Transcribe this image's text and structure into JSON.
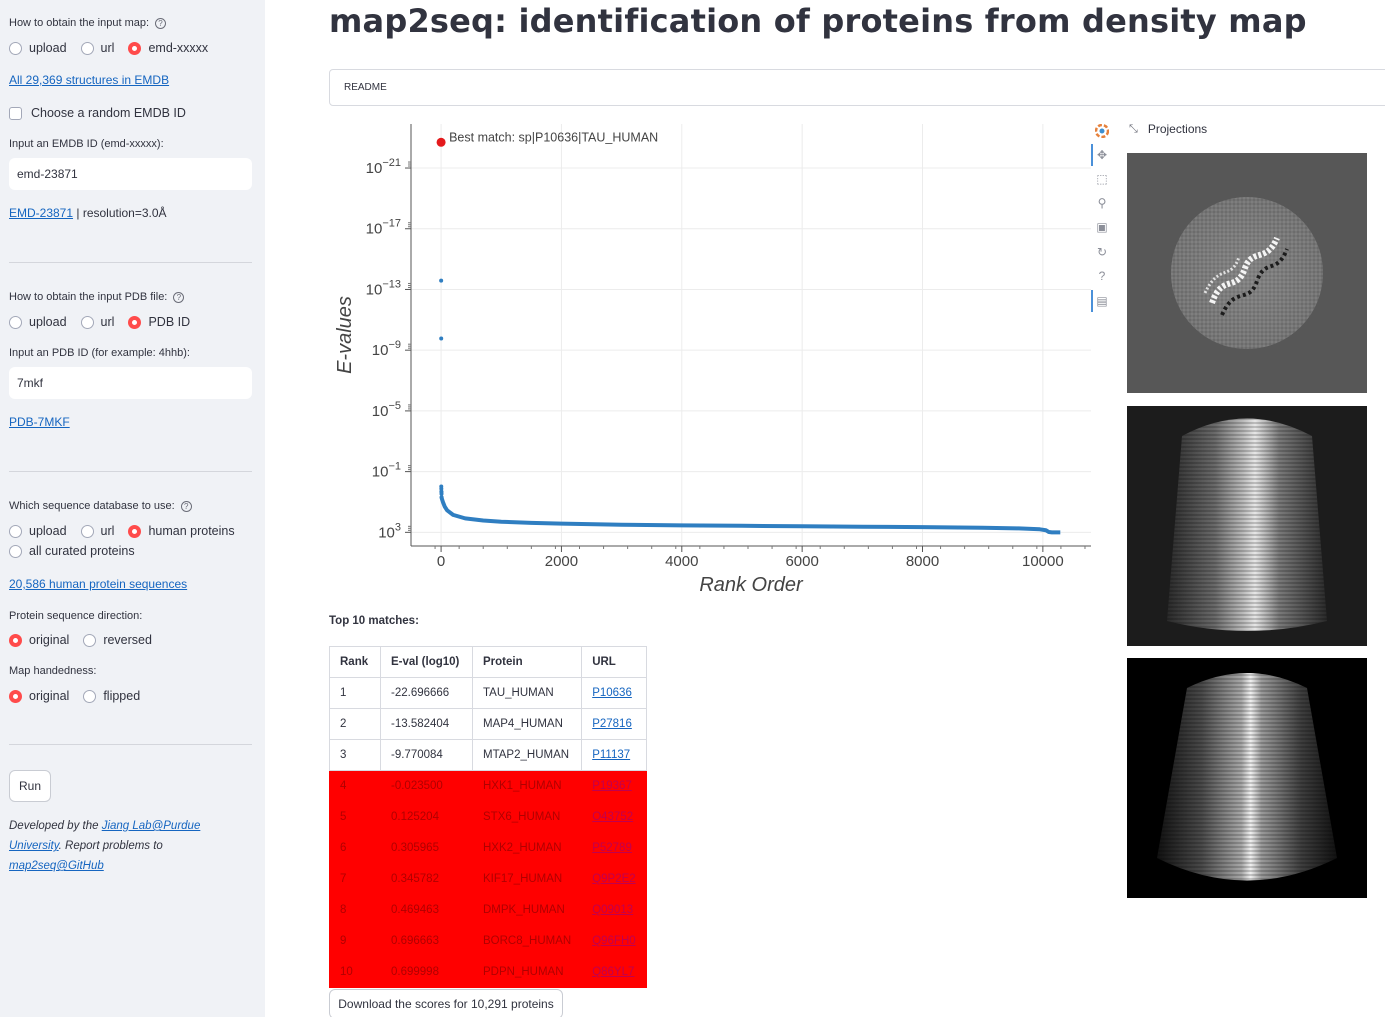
{
  "sidebar": {
    "map_source": {
      "label": "How to obtain the input map:",
      "options": [
        "upload",
        "url",
        "emd-xxxxx"
      ],
      "selected": 2
    },
    "emdb_link": "All 29,369 structures in EMDB",
    "random_checkbox": "Choose a random EMDB ID",
    "emdb_input": {
      "label": "Input an EMDB ID (emd-xxxxx):",
      "value": "emd-23871"
    },
    "emd_info": {
      "link": "EMD-23871",
      "text": " | resolution=3.0Å"
    },
    "pdb_source": {
      "label": "How to obtain the input PDB file:",
      "options": [
        "upload",
        "url",
        "PDB ID"
      ],
      "selected": 2
    },
    "pdb_input": {
      "label": "Input an PDB ID (for example: 4hhb):",
      "value": "7mkf"
    },
    "pdb_link": "PDB-7MKF",
    "seq_db": {
      "label": "Which sequence database to use:",
      "options": [
        "upload",
        "url",
        "human proteins",
        "all curated proteins"
      ],
      "selected": 2
    },
    "human_seq_link": "20,586 human protein sequences",
    "direction": {
      "label": "Protein sequence direction:",
      "options": [
        "original",
        "reversed"
      ],
      "selected": 0
    },
    "handedness": {
      "label": "Map handedness:",
      "options": [
        "original",
        "flipped"
      ],
      "selected": 0
    },
    "run_label": "Run",
    "footer": {
      "prefix": "Developed by the ",
      "lab_link": "Jiang Lab@Purdue University",
      "middle": ". Report problems to ",
      "github_link": "map2seq@GitHub"
    }
  },
  "main": {
    "title": "map2seq: identification of proteins from density map",
    "readme": "README",
    "projections_title": "Projections",
    "top10_label": "Top 10 matches:",
    "download_label": "Download the scores for 10,291 proteins"
  },
  "table": {
    "headers": [
      "Rank",
      "E-val (log10)",
      "Protein",
      "URL"
    ],
    "rows": [
      [
        "1",
        "-22.696666",
        "TAU_HUMAN",
        "P10636"
      ],
      [
        "2",
        "-13.582404",
        "MAP4_HUMAN",
        "P27816"
      ],
      [
        "3",
        "-9.770084",
        "MTAP2_HUMAN",
        "P11137"
      ],
      [
        "4",
        "-0.023500",
        "HXK1_HUMAN",
        "P19367"
      ],
      [
        "5",
        "0.125204",
        "STX6_HUMAN",
        "O43752"
      ],
      [
        "6",
        "0.305965",
        "HXK2_HUMAN",
        "P52789"
      ],
      [
        "7",
        "0.345782",
        "KIF17_HUMAN",
        "Q9P2E2"
      ],
      [
        "8",
        "0.469463",
        "DMPK_HUMAN",
        "Q09013"
      ],
      [
        "9",
        "0.696663",
        "BORC8_HUMAN",
        "Q96FH0"
      ],
      [
        "10",
        "0.699998",
        "PDPN_HUMAN",
        "Q86YL7"
      ]
    ],
    "highlight_from": 3,
    "highlight_color": "#ff0000"
  },
  "colors": {
    "accent": "#ff4b4b",
    "link": "#1565c0",
    "series": "#2f7ec1",
    "best": "#e41a1c"
  },
  "chart_data": {
    "type": "scatter",
    "xlabel": "Rank Order",
    "ylabel": "E-values",
    "yscale": "log",
    "y_reversed": true,
    "xlim": [
      -500,
      10800
    ],
    "x_ticks": [
      0,
      2000,
      4000,
      6000,
      8000,
      10000
    ],
    "y_tick_exponents": [
      -21,
      -17,
      -13,
      -9,
      -5,
      -1,
      3
    ],
    "ylim_log10": [
      -23.9,
      3.9
    ],
    "grid": true,
    "legend": {
      "label": "Best match: sp|P10636|TAU_HUMAN",
      "placement": "top-left"
    },
    "best_match": {
      "rank": 0,
      "log10_eval": -22.696666
    },
    "points": [
      [
        1,
        -13.582404
      ],
      [
        2,
        -9.770084
      ],
      [
        3,
        -0.0235
      ],
      [
        4,
        0.125204
      ],
      [
        5,
        0.305965
      ],
      [
        6,
        0.345782
      ],
      [
        7,
        0.469463
      ],
      [
        8,
        0.696663
      ],
      [
        9,
        0.699998
      ]
    ],
    "curve": [
      [
        10,
        0.75
      ],
      [
        30,
        1.0
      ],
      [
        60,
        1.3
      ],
      [
        100,
        1.55
      ],
      [
        200,
        1.85
      ],
      [
        400,
        2.08
      ],
      [
        700,
        2.22
      ],
      [
        1000,
        2.3
      ],
      [
        1500,
        2.38
      ],
      [
        2000,
        2.43
      ],
      [
        3000,
        2.5
      ],
      [
        4000,
        2.54
      ],
      [
        5000,
        2.57
      ],
      [
        6000,
        2.6
      ],
      [
        7000,
        2.63
      ],
      [
        8000,
        2.66
      ],
      [
        9000,
        2.7
      ],
      [
        9600,
        2.74
      ],
      [
        9950,
        2.8
      ],
      [
        10050,
        2.86
      ],
      [
        10100,
        2.98
      ],
      [
        10150,
        3.0
      ],
      [
        10290,
        3.0
      ]
    ]
  }
}
